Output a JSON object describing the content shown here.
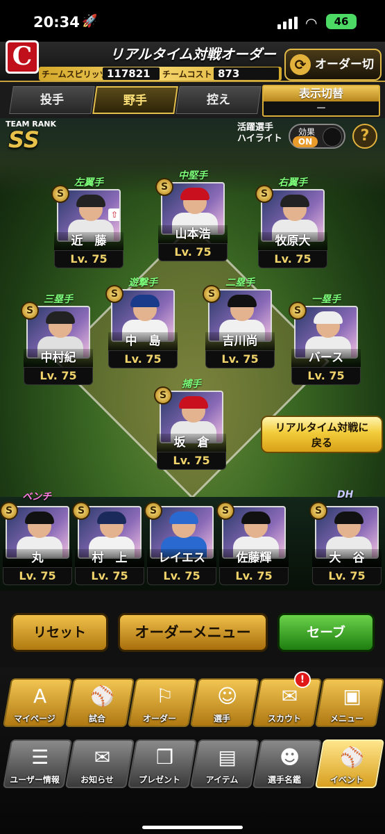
{
  "status": {
    "time": "20:34",
    "battery": "46"
  },
  "header": {
    "logo": "C",
    "title": "リアルタイム対戦オーダー",
    "spirit_label": "チームスピリッツ",
    "spirit_value": "117821",
    "cost_label": "チームコスト",
    "cost_value": "873",
    "order_switch": "オーダー切替"
  },
  "tabs": [
    {
      "label": "投手",
      "active": false
    },
    {
      "label": "野手",
      "active": true
    },
    {
      "label": "控え",
      "active": false
    }
  ],
  "display_switch": {
    "label": "表示切替",
    "value": "－"
  },
  "team_rank": {
    "label": "TEAM RANK",
    "value": "SS"
  },
  "highlight": {
    "label_1": "活躍選手",
    "label_2": "ハイライト",
    "effect_label": "効果",
    "effect_state": "ON"
  },
  "help": "?",
  "lineup": [
    {
      "pos": "左翼手",
      "name": "近　藤",
      "lv": "Lv. 75",
      "cap": "#222",
      "body": "#e8e8e8"
    },
    {
      "pos": "中堅手",
      "name": "山本浩",
      "lv": "Lv. 75",
      "cap": "#c8101e",
      "body": "#f0f0f0"
    },
    {
      "pos": "右翼手",
      "name": "牧原大",
      "lv": "Lv. 75",
      "cap": "#222",
      "body": "#eaeaea"
    },
    {
      "pos": "三塁手",
      "name": "中村紀",
      "lv": "Lv. 75",
      "cap": "#222",
      "body": "#e0e0e0"
    },
    {
      "pos": "遊撃手",
      "name": "中　島",
      "lv": "Lv. 75",
      "cap": "#1a3a8a",
      "body": "#f2f2f2"
    },
    {
      "pos": "二塁手",
      "name": "吉川尚",
      "lv": "Lv. 75",
      "cap": "#111",
      "body": "#f0f0f0"
    },
    {
      "pos": "一塁手",
      "name": "バース",
      "lv": "Lv. 75",
      "cap": "#eeeeee",
      "body": "#ececec"
    },
    {
      "pos": "捕手",
      "name": "坂　倉",
      "lv": "Lv. 75",
      "cap": "#c8101e",
      "body": "#e8e8e8"
    }
  ],
  "return_button": {
    "line_1": "リアルタイム対戦に",
    "line_2": "戻る"
  },
  "bench_label": "ベンチ",
  "dh_label": "DH",
  "bench": [
    {
      "name": "丸",
      "lv": "Lv. 75",
      "cap": "#111",
      "body": "#eeeeee"
    },
    {
      "name": "村　上",
      "lv": "Lv. 75",
      "cap": "#1a2a5a",
      "body": "#f2f2f2"
    },
    {
      "name": "レイエス",
      "lv": "Lv. 75",
      "cap": "#2a6ad0",
      "body": "#2a6ad0"
    },
    {
      "name": "佐藤輝",
      "lv": "Lv. 75",
      "cap": "#111",
      "body": "#efefef"
    },
    {
      "name": "大　谷",
      "lv": "Lv. 75",
      "cap": "#111",
      "body": "#eaeaea"
    }
  ],
  "actions": {
    "reset": "リセット",
    "order_menu": "オーダーメニュー",
    "save": "セーブ"
  },
  "nav_row_1": [
    {
      "label": "マイページ",
      "icon": "A"
    },
    {
      "label": "試合",
      "icon": "⚾"
    },
    {
      "label": "オーダー",
      "icon": "⚐"
    },
    {
      "label": "選手",
      "icon": "☺"
    },
    {
      "label": "スカウト",
      "icon": "✉"
    },
    {
      "label": "メニュー",
      "icon": "▣"
    }
  ],
  "scout_badge": "!",
  "nav_row_2": [
    {
      "label": "ユーザー情報",
      "icon": "☰"
    },
    {
      "label": "お知らせ",
      "icon": "✉"
    },
    {
      "label": "プレゼント",
      "icon": "❒"
    },
    {
      "label": "アイテム",
      "icon": "▤"
    },
    {
      "label": "選手名鑑",
      "icon": "☻"
    },
    {
      "label": "イベント",
      "icon": "⚾"
    }
  ]
}
